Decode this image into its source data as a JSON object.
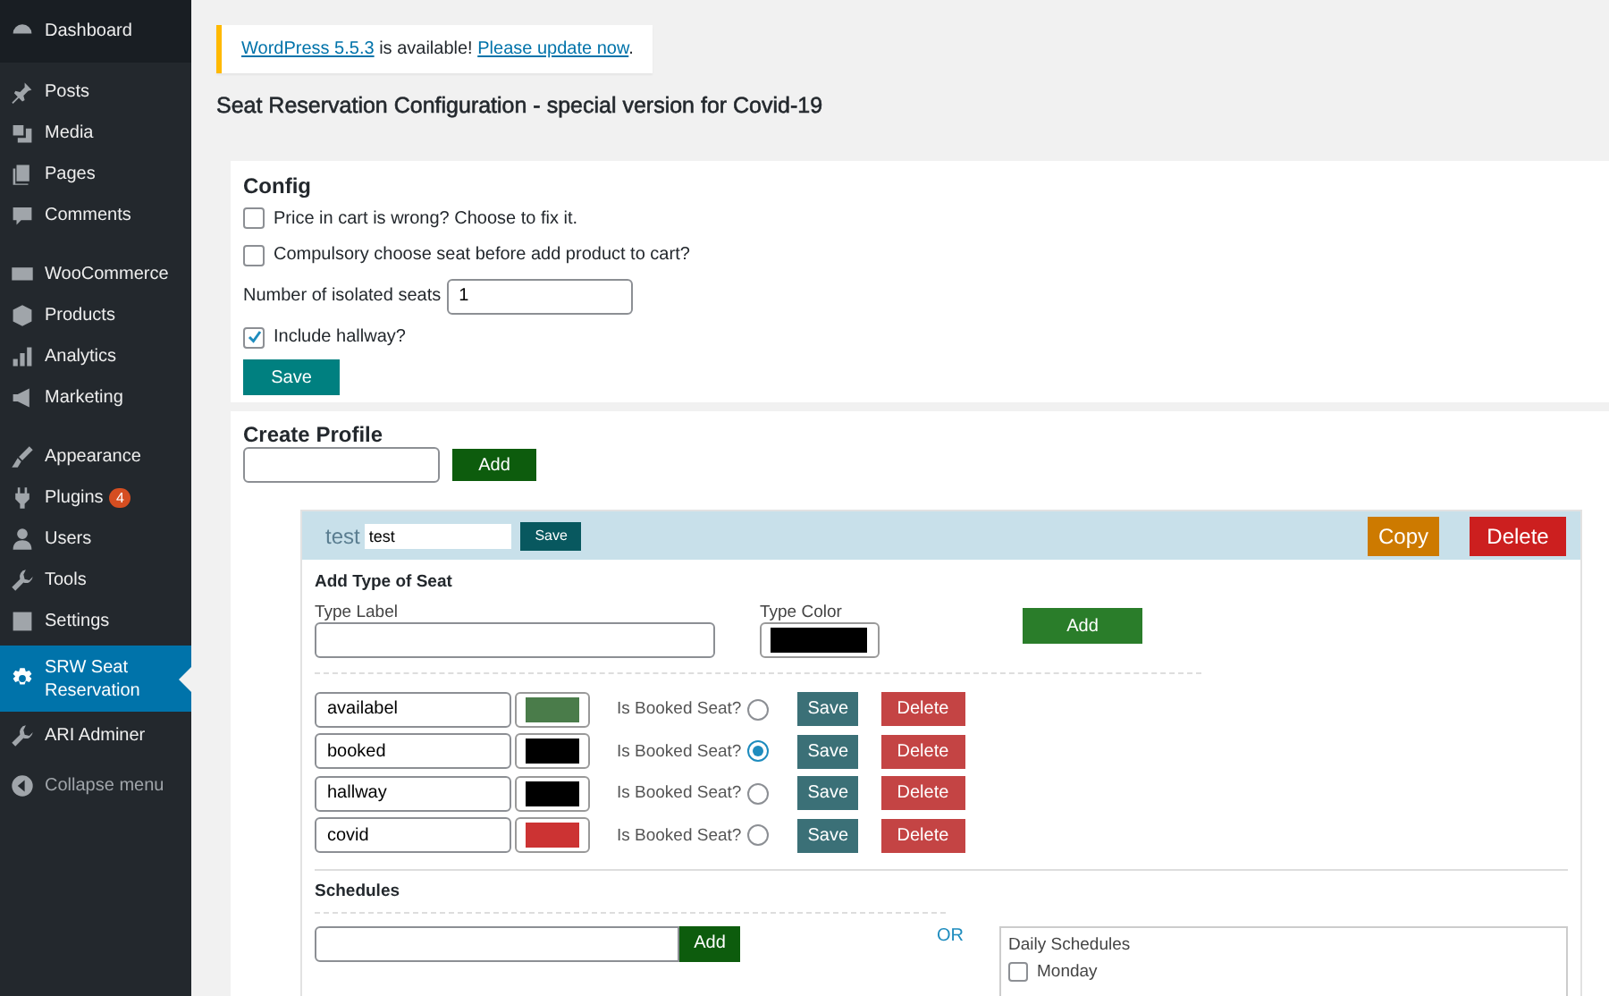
{
  "sidebar": {
    "groups": [
      [
        {
          "label": "Dashboard",
          "selected": false
        }
      ],
      [
        {
          "label": "Posts",
          "selected": false
        },
        {
          "label": "Media",
          "selected": false
        },
        {
          "label": "Pages",
          "selected": false
        },
        {
          "label": "Comments",
          "selected": false
        }
      ],
      [
        {
          "label": "WooCommerce",
          "selected": false
        },
        {
          "label": "Products",
          "selected": false
        },
        {
          "label": "Analytics",
          "selected": false
        },
        {
          "label": "Marketing",
          "selected": false
        }
      ],
      [
        {
          "label": "Appearance",
          "selected": false
        },
        {
          "label": "Plugins",
          "selected": false,
          "badge": "4"
        },
        {
          "label": "Users",
          "selected": false
        },
        {
          "label": "Tools",
          "selected": false
        },
        {
          "label": "Settings",
          "selected": false
        },
        {
          "label": "SRW Seat Reservation",
          "selected": true
        },
        {
          "label": "ARI Adminer",
          "selected": false
        }
      ]
    ],
    "collapse_label": "Collapse menu"
  },
  "notice": {
    "parts": [
      {
        "kind": "link",
        "text": "WordPress 5.5.3"
      },
      {
        "kind": "text",
        "text": " is available! "
      },
      {
        "kind": "link",
        "text": "Please update now"
      },
      {
        "kind": "text",
        "text": "."
      }
    ]
  },
  "page_title": "Seat Reservation Configuration - special version for Covid-19",
  "config": {
    "title": "Config",
    "options": [
      {
        "kind": "checkbox",
        "label": "Price in cart is wrong? Choose to fix it.",
        "checked": false
      },
      {
        "kind": "checkbox",
        "label": "Compulsory choose seat before add product to cart?",
        "checked": false
      },
      {
        "kind": "number",
        "label": "Number of isolated seats",
        "value": "1"
      },
      {
        "kind": "checkbox",
        "label": "Include hallway?",
        "checked": true
      }
    ],
    "save": "Save"
  },
  "create_profile": {
    "title": "Create Profile",
    "add": "Add"
  },
  "profile": {
    "name": "test",
    "name_value": "test",
    "save": "Save",
    "copy": "Copy",
    "delete": "Delete",
    "add_type": {
      "title": "Add Type of Seat",
      "label_caption": "Type Label",
      "color_caption": "Type Color",
      "color": "#000000",
      "add": "Add"
    },
    "seat_types": [
      {
        "name": "availabel",
        "color": "#4a7c4a",
        "booked_label": "Is Booked Seat?",
        "booked": false,
        "save": "Save",
        "delete": "Delete"
      },
      {
        "name": "booked",
        "color": "#000000",
        "booked_label": "Is Booked Seat?",
        "booked": true,
        "save": "Save",
        "delete": "Delete"
      },
      {
        "name": "hallway",
        "color": "#000000",
        "booked_label": "Is Booked Seat?",
        "booked": false,
        "save": "Save",
        "delete": "Delete"
      },
      {
        "name": "covid",
        "color": "#cc3333",
        "booked_label": "Is Booked Seat?",
        "booked": false,
        "save": "Save",
        "delete": "Delete"
      }
    ],
    "schedules": {
      "title": "Schedules",
      "add": "Add",
      "or": "OR",
      "daily": {
        "title": "Daily Schedules",
        "days": [
          {
            "label": "Monday",
            "checked": false
          }
        ]
      }
    }
  }
}
